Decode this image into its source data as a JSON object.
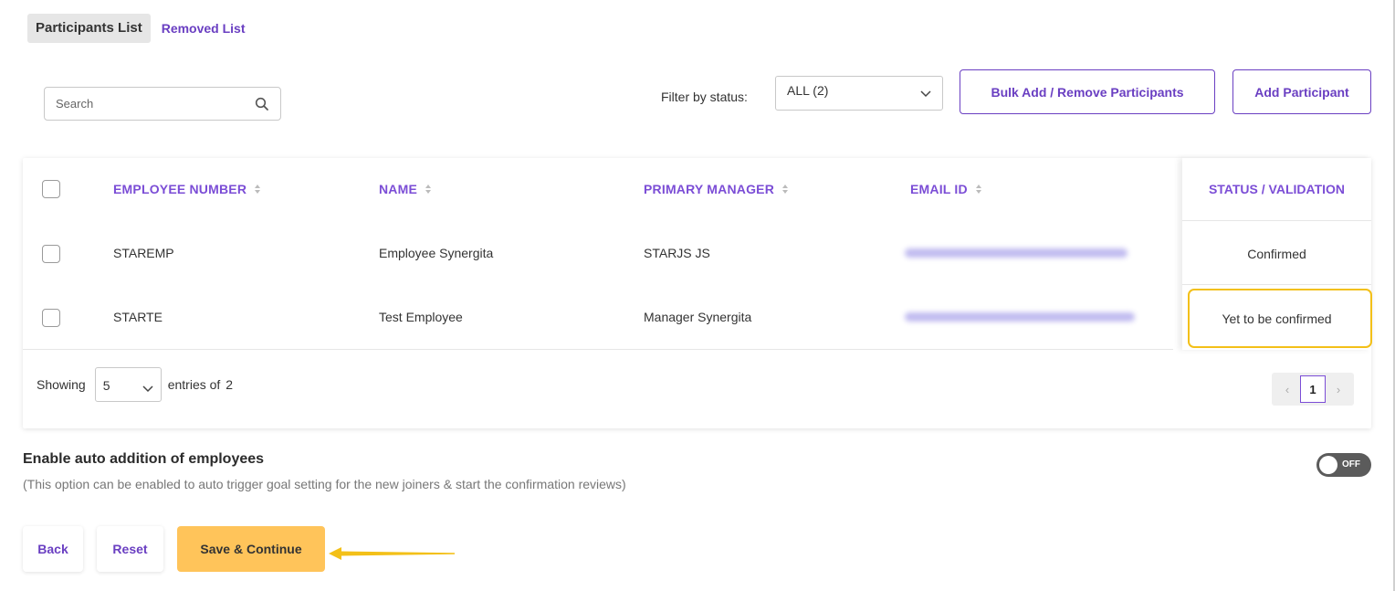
{
  "tabs": [
    {
      "label": "Participants List",
      "active": true
    },
    {
      "label": "Removed List",
      "active": false
    }
  ],
  "search": {
    "placeholder": "Search"
  },
  "filter": {
    "label": "Filter by status:",
    "value": "ALL (2)"
  },
  "buttons": {
    "bulk": "Bulk Add / Remove Participants",
    "add": "Add Participant",
    "back": "Back",
    "reset": "Reset",
    "save": "Save & Continue"
  },
  "table": {
    "headers": {
      "employee_number": "EMPLOYEE NUMBER",
      "name": "NAME",
      "manager": "PRIMARY MANAGER",
      "email": "EMAIL ID",
      "status": "STATUS / VALIDATION"
    },
    "rows": [
      {
        "employee_number": "STAREMP",
        "name": "Employee Synergita",
        "manager": "STARJS JS",
        "status": "Confirmed"
      },
      {
        "employee_number": "STARTE",
        "name": "Test Employee",
        "manager": "Manager Synergita",
        "status": "Yet to be confirmed"
      }
    ]
  },
  "footer": {
    "showing": "Showing",
    "page_size": "5",
    "entries_of": "entries of",
    "total": "2",
    "current_page": "1",
    "prev": "‹",
    "next": "›"
  },
  "auto_addition": {
    "title": "Enable auto addition of employees",
    "description": "(This option can be enabled to auto trigger goal setting for the new joiners & start the confirmation reviews)",
    "toggle_label": "OFF"
  },
  "colors": {
    "accent": "#6a3fc2",
    "highlight": "#f3c018",
    "save_button": "#ffc45a"
  }
}
